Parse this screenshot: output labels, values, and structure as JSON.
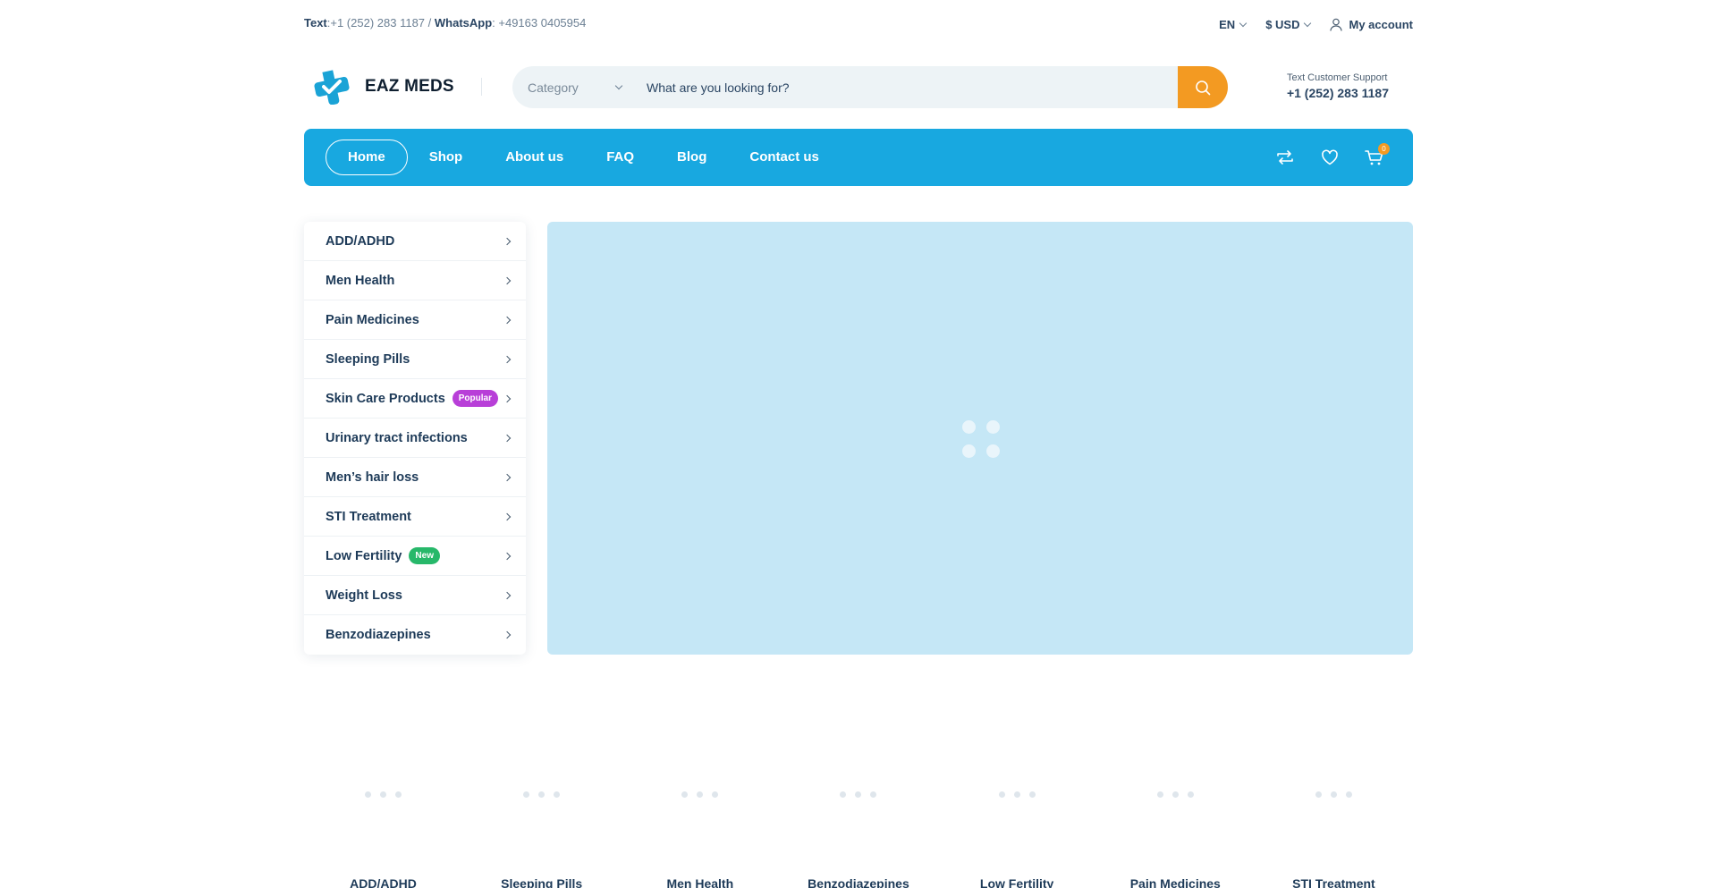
{
  "topbar": {
    "text_label": "Text",
    "text_phone": ":+1 (252) 283 1187 / ",
    "whatsapp_label": "WhatsApp",
    "whatsapp_phone": ": +49163 0405954",
    "language": "EN",
    "currency": "$ USD",
    "account": "My account"
  },
  "header": {
    "logo_text": "EAZ MEDS",
    "category_select": "Category",
    "search_placeholder": "What are you looking for?",
    "support_label": "Text Customer Support",
    "support_phone": "+1 (252) 283 1187"
  },
  "nav": {
    "items": [
      "Home",
      "Shop",
      "About us",
      "FAQ",
      "Blog",
      "Contact us"
    ],
    "active": "Home",
    "cart_count": "0"
  },
  "sidebar": {
    "items": [
      {
        "label": "ADD/ADHD"
      },
      {
        "label": "Men Health"
      },
      {
        "label": "Pain Medicines"
      },
      {
        "label": "Sleeping Pills"
      },
      {
        "label": "Skin Care Products",
        "badge": "Popular",
        "badge_color": "#b83fd8"
      },
      {
        "label": "Urinary tract infections"
      },
      {
        "label": "Men’s hair loss"
      },
      {
        "label": "STI Treatment"
      },
      {
        "label": "Low Fertility",
        "badge": "New",
        "badge_color": "#27b86a"
      },
      {
        "label": "Weight Loss"
      },
      {
        "label": "Benzodiazepines"
      }
    ]
  },
  "categories": [
    "ADD/ADHD",
    "Sleeping Pills",
    "Men Health",
    "Benzodiazepines",
    "Low Fertility",
    "Pain Medicines",
    "STI Treatment"
  ],
  "colors": {
    "accent_blue": "#18a8e0",
    "accent_orange": "#f39a22",
    "banner_bg": "#c5e7f6",
    "text_dark": "#1d3a58"
  }
}
